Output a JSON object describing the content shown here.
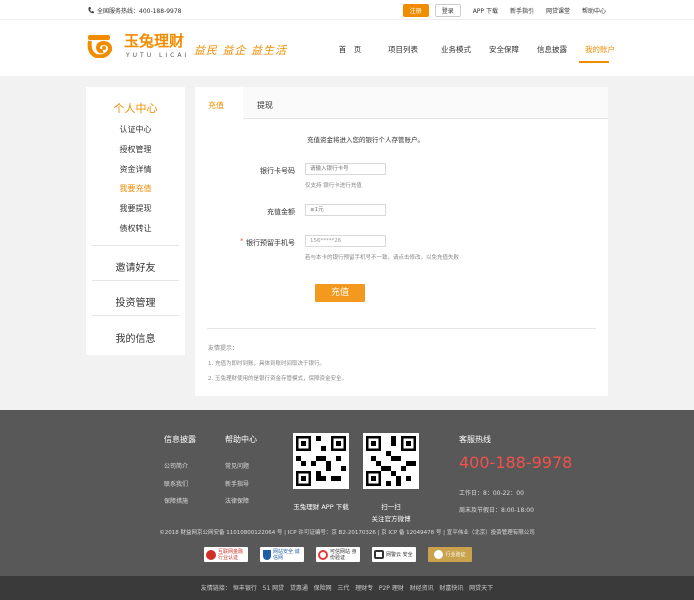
{
  "topbar": {
    "hotline": "全国服务热线：400-188-9978",
    "register": "注册",
    "login": "登录",
    "links": [
      "APP 下载",
      "新手指引",
      "网贷课堂",
      "帮助中心"
    ]
  },
  "header": {
    "logo_cn": "玉兔理财",
    "logo_en": "YUTU LICAI",
    "slogan": "益民 益企 益生活",
    "nav": [
      "首　页",
      "项目列表",
      "业务模式",
      "安全保障",
      "信息披露",
      "我的账户"
    ],
    "active_nav": "我的账户"
  },
  "sidebar": {
    "title": "个人中心",
    "items": [
      "认证中心",
      "授权管理",
      "资金详情",
      "我要充值",
      "我要提现",
      "债权转让"
    ],
    "active": "我要充值",
    "sections": [
      "邀请好友",
      "投资管理",
      "我的信息"
    ]
  },
  "main": {
    "tabs": [
      "充值",
      "提现"
    ],
    "notice": "充值资金将进入您的银行个人存管账户。",
    "card_label": "银行卡号码",
    "card_placeholder": "请输入银行卡号",
    "card_hint": "仅支持 银行卡进行充值",
    "amount_label": "充值金额",
    "amount_placeholder": "≥1元",
    "phone_required": "*",
    "phone_label": "银行预留手机号",
    "phone_value": "156*****26",
    "phone_hint": "若与本卡的银行预留手机号不一致，请点击修改，以免充值失败",
    "submit": "充值",
    "tips_title": "友情提示：",
    "tips": [
      "1. 充值为即时到账，具体到账时间取决于银行。",
      "2. 玉兔理财使用的是银行资金存管模式，保障资金安全。"
    ]
  },
  "footer": {
    "col1_title": "信息披露",
    "col1_links": [
      "公司简介",
      "联系我们",
      "保障措施"
    ],
    "col2_title": "帮助中心",
    "col2_links": [
      "常见问题",
      "新手指导",
      "法律保障"
    ],
    "qr1_caption": "玉兔理财 APP 下载",
    "qr2_caption_1": "扫一扫",
    "qr2_caption_2": "关注官方微博",
    "service_title": "客服热线",
    "service_phone": "400-188-9978",
    "hours_1": "工作日：8：00-22：00",
    "hours_2": "周末及节假日：8:00-18:00",
    "copyright": "©2018 财益网京公网安备 11010800122064 号 | ICP 许可证编号：京 B2-20170326 | 京 ICP 备 12049478 号 | 宣平伟业（北京）投资管理有限公司",
    "badges": [
      "互联网金融 行业认证",
      "网站安全 诚信网",
      "可信网站 身份验证",
      "网警云 安全",
      "行业验证"
    ],
    "friend_label": "友情链接：",
    "friend_links": [
      "恒丰银行",
      "51 网贷",
      "贷惠通",
      "保险网",
      "三代",
      "理财专",
      "P2P 理财",
      "财经资讯",
      "财富快讯",
      "网贷天下"
    ]
  },
  "colors": {
    "accent": "#f08c00",
    "hotline": "#f0524b",
    "footer_bg": "#585858"
  }
}
